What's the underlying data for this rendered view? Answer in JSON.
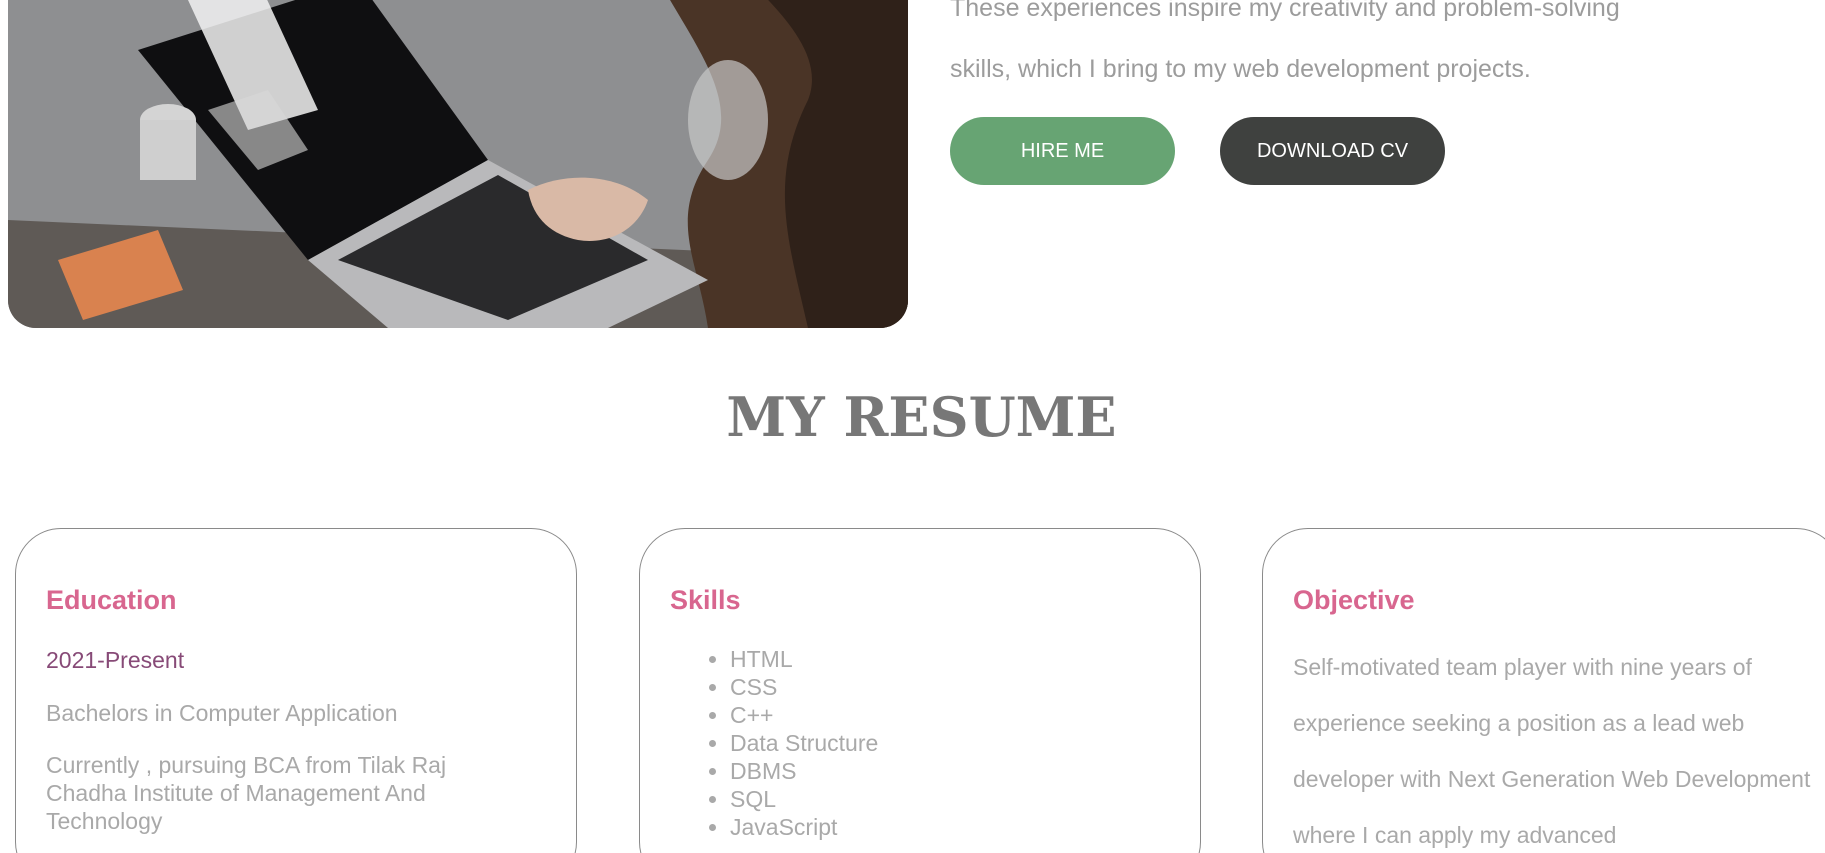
{
  "hero": {
    "text_line_1": "These experiences inspire my creativity and problem-solving",
    "text_line_2": "skills, which I bring to my web development projects.",
    "hire_label": "HIRE ME",
    "cv_label": "DOWNLOAD CV"
  },
  "resume": {
    "title": "MY RESUME",
    "education": {
      "heading": "Education",
      "period": "2021-Present",
      "degree": "Bachelors in Computer Application",
      "detail": "Currently , pursuing BCA from Tilak Raj Chadha Institute of Management And Technology"
    },
    "skills": {
      "heading": "Skills",
      "items": [
        "HTML",
        "CSS",
        "C++",
        "Data Structure",
        "DBMS",
        "SQL",
        "JavaScript"
      ]
    },
    "objective": {
      "heading": "Objective",
      "text": "Self-motivated team player with nine years of experience seeking a position as a lead web developer with Next Generation Web Development where I can apply my advanced"
    }
  },
  "colors": {
    "accent_pink": "#d8668f",
    "hire_green": "#67a473",
    "cv_dark": "#3f413f",
    "period_purple": "#874a77"
  }
}
